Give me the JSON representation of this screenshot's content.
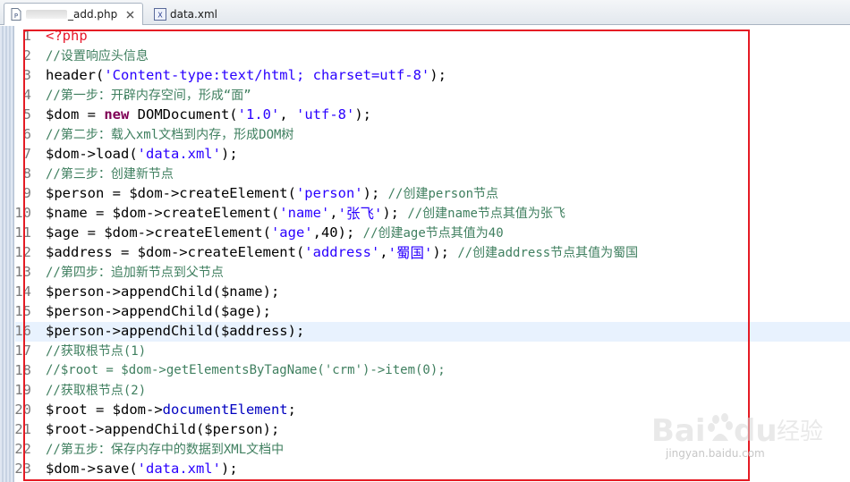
{
  "tabs": [
    {
      "label": "_add.php",
      "icon": "php-file-icon",
      "active": true
    },
    {
      "label": "data.xml",
      "icon": "xml-file-icon",
      "active": false
    }
  ],
  "editor": {
    "current_line": 16,
    "lines": [
      {
        "n": "1",
        "tokens": [
          [
            "tag",
            "<?php"
          ]
        ]
      },
      {
        "n": "2",
        "tokens": [
          [
            "cmt",
            "//设置响应头信息"
          ]
        ]
      },
      {
        "n": "3",
        "tokens": [
          [
            "def",
            "header("
          ],
          [
            "str",
            "'Content-type:text/html; charset=utf-8'"
          ],
          [
            "def",
            ");"
          ]
        ]
      },
      {
        "n": "4",
        "tokens": [
          [
            "cmt",
            "//第一步：开辟内存空间，形成“面”"
          ]
        ]
      },
      {
        "n": "5",
        "tokens": [
          [
            "def",
            "$dom = "
          ],
          [
            "kw",
            "new"
          ],
          [
            "def",
            " DOMDocument("
          ],
          [
            "str",
            "'1.0'"
          ],
          [
            "def",
            ", "
          ],
          [
            "str",
            "'utf-8'"
          ],
          [
            "def",
            ");"
          ]
        ]
      },
      {
        "n": "6",
        "tokens": [
          [
            "cmt",
            "//第二步：载入xml文档到内存，形成DOM树"
          ]
        ]
      },
      {
        "n": "7",
        "tokens": [
          [
            "def",
            "$dom->load("
          ],
          [
            "str",
            "'data.xml'"
          ],
          [
            "def",
            ");"
          ]
        ]
      },
      {
        "n": "8",
        "tokens": [
          [
            "cmt",
            "//第三步：创建新节点"
          ]
        ]
      },
      {
        "n": "9",
        "tokens": [
          [
            "def",
            "$person = $dom->createElement("
          ],
          [
            "str",
            "'person'"
          ],
          [
            "def",
            "); "
          ],
          [
            "cmt",
            "//创建person节点"
          ]
        ]
      },
      {
        "n": "10",
        "tokens": [
          [
            "def",
            "$name = $dom->createElement("
          ],
          [
            "str",
            "'name'"
          ],
          [
            "def",
            ","
          ],
          [
            "str",
            "'张飞'"
          ],
          [
            "def",
            "); "
          ],
          [
            "cmt",
            "//创建name节点其值为张飞"
          ]
        ]
      },
      {
        "n": "11",
        "tokens": [
          [
            "def",
            "$age = $dom->createElement("
          ],
          [
            "str",
            "'age'"
          ],
          [
            "def",
            ",40); "
          ],
          [
            "cmt",
            "//创建age节点其值为40"
          ]
        ]
      },
      {
        "n": "12",
        "tokens": [
          [
            "def",
            "$address = $dom->createElement("
          ],
          [
            "str",
            "'address'"
          ],
          [
            "def",
            ","
          ],
          [
            "str",
            "'蜀国'"
          ],
          [
            "def",
            "); "
          ],
          [
            "cmt",
            "//创建address节点其值为蜀国"
          ]
        ]
      },
      {
        "n": "13",
        "tokens": [
          [
            "cmt",
            "//第四步：追加新节点到父节点"
          ]
        ]
      },
      {
        "n": "14",
        "tokens": [
          [
            "def",
            "$person->appendChild($name);"
          ]
        ]
      },
      {
        "n": "15",
        "tokens": [
          [
            "def",
            "$person->appendChild($age);"
          ]
        ]
      },
      {
        "n": "16",
        "tokens": [
          [
            "def",
            "$person->appendChild($address);"
          ]
        ]
      },
      {
        "n": "17",
        "tokens": [
          [
            "cmt",
            "//获取根节点(1)"
          ]
        ]
      },
      {
        "n": "18",
        "tokens": [
          [
            "cmt",
            "//$root = $dom->getElementsByTagName('crm')->item(0);"
          ]
        ]
      },
      {
        "n": "19",
        "tokens": [
          [
            "cmt",
            "//获取根节点(2)"
          ]
        ]
      },
      {
        "n": "20",
        "tokens": [
          [
            "def",
            "$root = $dom->"
          ],
          [
            "prop",
            "documentElement"
          ],
          [
            "def",
            ";"
          ]
        ]
      },
      {
        "n": "21",
        "tokens": [
          [
            "def",
            "$root->appendChild($person);"
          ]
        ]
      },
      {
        "n": "22",
        "tokens": [
          [
            "cmt",
            "//第五步：保存内存中的数据到XML文档中"
          ]
        ]
      },
      {
        "n": "23",
        "tokens": [
          [
            "def",
            "$dom->save("
          ],
          [
            "str",
            "'data.xml'"
          ],
          [
            "def",
            ");"
          ]
        ]
      }
    ]
  },
  "watermark": {
    "brand": "Baidu",
    "brand_cn": "经验",
    "url": "jingyan.baidu.com"
  },
  "colors": {
    "highlight_box": "#e51b24",
    "current_line": "#e8f2fe",
    "comment": "#3f7f5f",
    "string": "#2a00ff",
    "keyword": "#7f0055",
    "php_tag": "#e8192c"
  }
}
